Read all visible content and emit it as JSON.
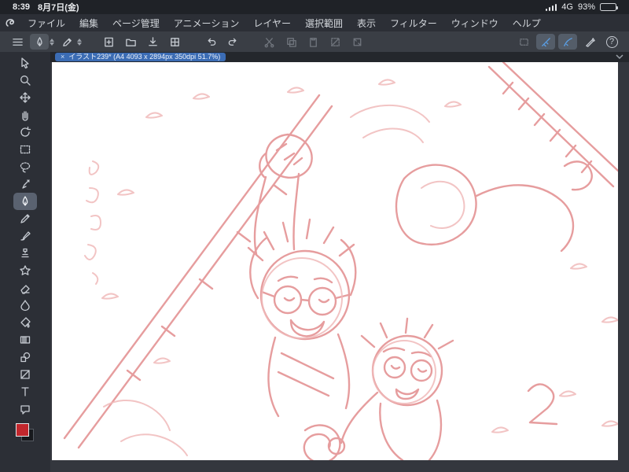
{
  "status_bar": {
    "time": "8:39",
    "date": "8月7日(金)",
    "network": "4G",
    "battery_percent": "93%"
  },
  "menu_bar": {
    "items": [
      "ファイル",
      "編集",
      "ページ管理",
      "アニメーション",
      "レイヤー",
      "選択範囲",
      "表示",
      "フィルター",
      "ウィンドウ",
      "ヘルプ"
    ]
  },
  "toolbar": {
    "buttons": [
      "menu",
      "tool-current",
      "tool-secondary",
      "new-canvas",
      "open-file",
      "export",
      "undo",
      "redo",
      "cut",
      "copy",
      "deselect",
      "transform",
      "select-area",
      "snap-ruler",
      "snap-special-ruler",
      "ruler-pen",
      "help"
    ],
    "help_label": "?"
  },
  "document_tab": {
    "close_label": "×",
    "title": "イラスト239* (A4 4093 x 2894px 350dpi 51.7%)"
  },
  "tool_palette": {
    "selected": "pen",
    "items": [
      "operation",
      "zoom",
      "move",
      "hand",
      "rotate",
      "selection",
      "lasso",
      "eyedropper",
      "pen",
      "pencil",
      "brush",
      "airbrush",
      "decoration",
      "eraser",
      "blend",
      "fill",
      "gradient",
      "figure",
      "frame",
      "text",
      "balloon"
    ],
    "foreground_color": "#c2272d"
  },
  "colors": {
    "accent_blue": "#5aa0e8",
    "tab_blue": "#3b6cb4",
    "sketch_pink": "#e59899",
    "canvas_white": "#ffffff"
  }
}
